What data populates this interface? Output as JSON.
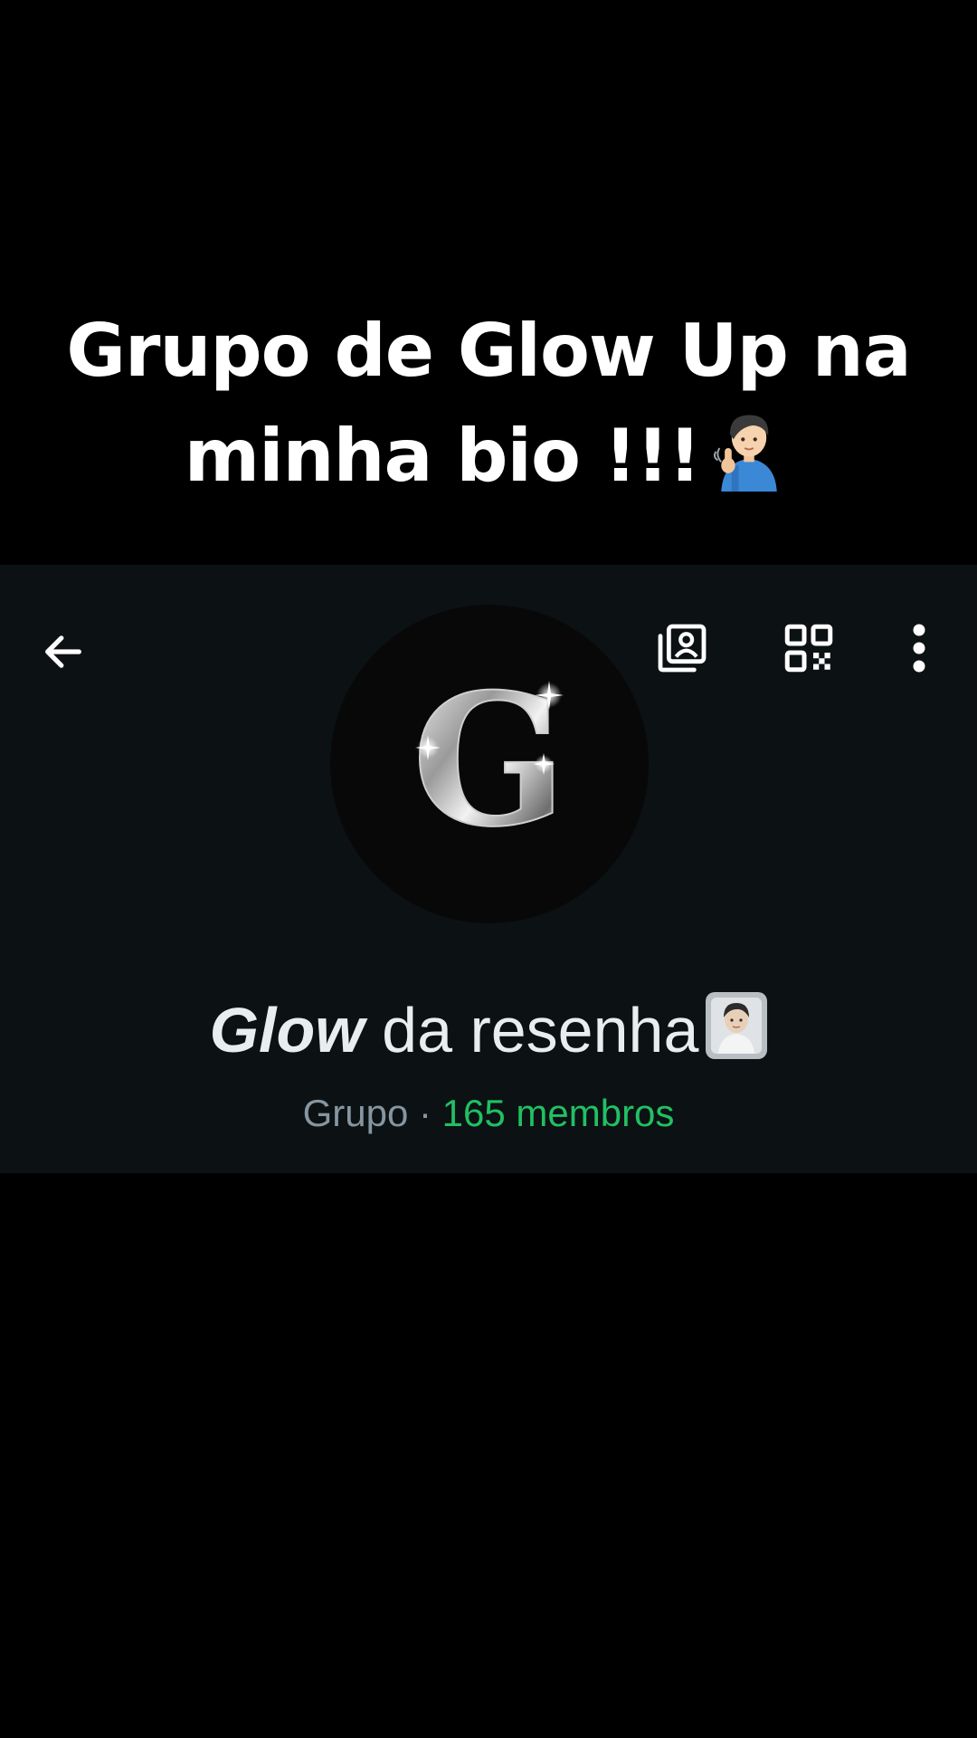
{
  "caption": {
    "line1": "Grupo de Glow Up na",
    "line2": "minha bio !!!",
    "emoji": "man-tipping-hand-emoji"
  },
  "header": {
    "back_icon": "arrow-left-icon",
    "contact_icon": "contact-card-icon",
    "qr_icon": "qr-code-icon",
    "more_icon": "more-vertical-icon"
  },
  "group": {
    "avatar_letter": "G",
    "name_bold": "Glow",
    "name_rest": " da resenha",
    "name_emoji": "person-sticker-emoji",
    "type": "Grupo",
    "separator": " · ",
    "members": "165 membros"
  },
  "colors": {
    "background": "#000000",
    "panel": "#0c1114",
    "text_primary": "#e9edef",
    "text_secondary": "#8696a0",
    "accent_green": "#21c063"
  }
}
